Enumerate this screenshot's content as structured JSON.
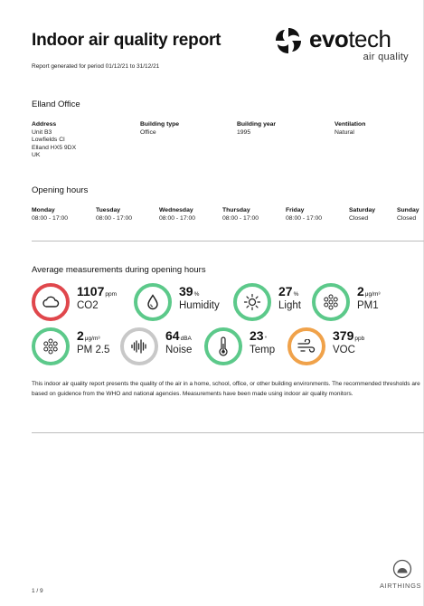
{
  "report": {
    "title": "Indoor air quality report",
    "period": "Report generated for period 01/12/21 to 31/12/21"
  },
  "brand": {
    "word_bold": "evo",
    "word_light": "tech",
    "subtitle": "air quality",
    "partner_logo": "AIRTHINGS"
  },
  "office": {
    "name": "Elland Office",
    "address_label": "Address",
    "address_lines": [
      "Unit B3",
      "Lowfields Cl",
      "Elland HX5 9DX",
      "UK"
    ],
    "building_type_label": "Building type",
    "building_type": "Office",
    "building_year_label": "Building year",
    "building_year": "1995",
    "ventilation_label": "Ventilation",
    "ventilation": "Natural"
  },
  "opening_hours": {
    "title": "Opening hours",
    "days": [
      {
        "day": "Monday",
        "hours": "08:00 - 17:00"
      },
      {
        "day": "Tuesday",
        "hours": "08:00 - 17:00"
      },
      {
        "day": "Wednesday",
        "hours": "08:00 - 17:00"
      },
      {
        "day": "Thursday",
        "hours": "08:00 - 17:00"
      },
      {
        "day": "Friday",
        "hours": "08:00 - 17:00"
      },
      {
        "day": "Saturday",
        "hours": "Closed"
      },
      {
        "day": "Sunday",
        "hours": "Closed"
      }
    ]
  },
  "measurements": {
    "title": "Average measurements during opening hours",
    "items": [
      {
        "value": "1107",
        "unit": "ppm",
        "label": "CO2",
        "icon": "cloud-icon",
        "status_color": "#e0474c"
      },
      {
        "value": "39",
        "unit": "%",
        "label": "Humidity",
        "icon": "droplet-icon",
        "status_color": "#5cc98a"
      },
      {
        "value": "27",
        "unit": "%",
        "label": "Light",
        "icon": "sun-icon",
        "status_color": "#5cc98a"
      },
      {
        "value": "2",
        "unit": "μg/m³",
        "label": "PM1",
        "icon": "particles-icon",
        "status_color": "#5cc98a"
      },
      {
        "value": "2",
        "unit": "μg/m³",
        "label": "PM 2.5",
        "icon": "particles-icon",
        "status_color": "#5cc98a"
      },
      {
        "value": "64",
        "unit": "dBA",
        "label": "Noise",
        "icon": "soundwave-icon",
        "status_color": "#c8c8c8"
      },
      {
        "value": "23",
        "unit": "°",
        "label": "Temp",
        "icon": "thermometer-icon",
        "status_color": "#5cc98a"
      },
      {
        "value": "379",
        "unit": "ppb",
        "label": "VOC",
        "icon": "wind-icon",
        "status_color": "#f0a24a"
      }
    ]
  },
  "description": "This indoor air quality report presents the quality of the air in a home, school, office, or other building environments. The recommended thresholds are based on guidence from the WHO and national agencies. Measurements have been made using indoor air quality monitors.",
  "footer": {
    "page": "1 / 9"
  }
}
